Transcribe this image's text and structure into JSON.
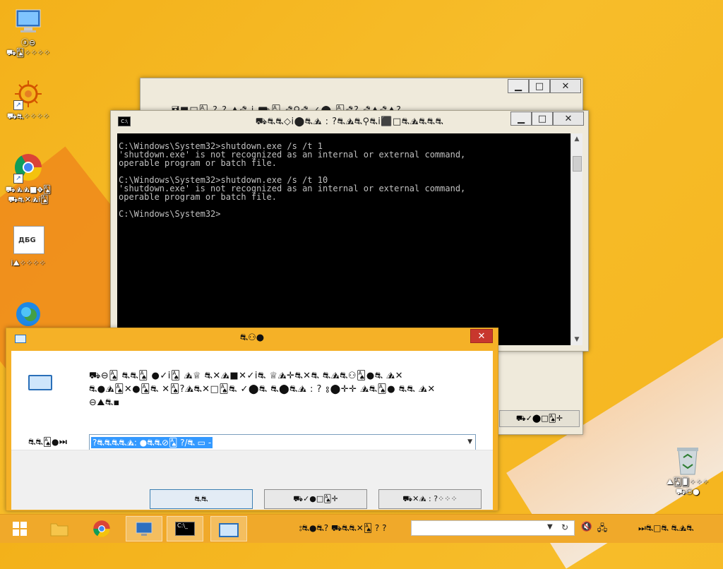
{
  "desktop": {
    "icons": [
      {
        "name": "this-pc",
        "label": "ⓐ⊖\n⛟🂡⁘⁘⁘⁘"
      },
      {
        "name": "app-shortcut",
        "label": "⛟⛐⁘⁘⁘⁘"
      },
      {
        "name": "chrome",
        "label": "⛟⛰⛰■⛖🂡\n⛟⛐✕⛰i🂡"
      },
      {
        "name": "document",
        "label": "i⛰⁘⁘⁘⁘"
      },
      {
        "name": "edge",
        "label": ""
      },
      {
        "name": "recycle-bin",
        "label": "⛰🂡🂠⁘⁘⁘\n⛟⚇●"
      }
    ],
    "document_icon_text": "ДБG"
  },
  "back_window": {
    "title": "🖬■□🂡 ? ? ⛰⛐ i ⛟🂡 ⛐⚲⛐ ✓⬤ 🂡⛐? ⛐⛰⛐⛰?",
    "button": "⛟✓⬤□🂡✛"
  },
  "cmd_window": {
    "title": "⛟⛐⛐◇i⬤⛐⛰ : ?⛐⛰⛐⚲⛐i⬛□⛐⛰⛐⛐⛐",
    "lines": [
      "C:\\Windows\\System32>shutdown.exe /s /t 1",
      "'shutdown.exe' is not recognized as an internal or external command,",
      "operable program or batch file.",
      "",
      "C:\\Windows\\System32>shutdown.exe /s /t 10",
      "'shutdown.exe' is not recognized as an internal or external command,",
      "operable program or batch file.",
      "",
      "C:\\Windows\\System32>"
    ]
  },
  "run_dialog": {
    "title": "⛐⚇●",
    "description": "⛟⊖🂡 ⛐⛐🂡 ●✓i🂡 ⛰♕ ⛐✕⛰■✕✓i⛐ ♕⛰✛⛐✕⛐ ⛐⛰⛐⚇🂡●⛐ ⛰✕\n⛐●⛰🂡✕●🂡⛐ ✕🂡?⛰⛐✕□🂡⛐ ✓⬤⛐ ⛐⬤⛐⛰ : ? ⦂⬤✛✛ ⛰⛐🂡● ⛐⛐ ⛰✕\n⊖⛰⛐▪",
    "open_label": "⛐⛐🂡●⏭",
    "input_value": "?⛐⛐⛐⛐⛰: ●⛐⛐⊘🂡 ?/⛐ ▭ -",
    "buttons": {
      "ok": "⛐⛐",
      "cancel": "⛟✓●□🂡✛",
      "browse": "⛟✕⛰ : ?⁘⁘⁘"
    }
  },
  "taskbar": {
    "text": "⦂⛐●⛐? ⛟⛐⛐✕🂡 ? ?",
    "search_placeholder": "",
    "right_text": "⏭⛐□⛐ ⛐⛰⛐"
  }
}
